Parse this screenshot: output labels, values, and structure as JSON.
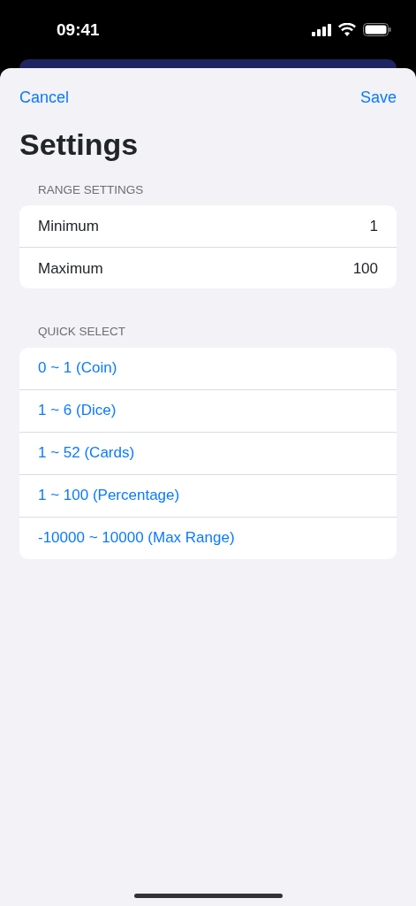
{
  "status_bar": {
    "time": "09:41"
  },
  "nav": {
    "cancel": "Cancel",
    "save": "Save"
  },
  "title": "Settings",
  "range_section": {
    "header": "RANGE SETTINGS",
    "rows": [
      {
        "label": "Minimum",
        "value": "1"
      },
      {
        "label": "Maximum",
        "value": "100"
      }
    ]
  },
  "quick_section": {
    "header": "QUICK SELECT",
    "items": [
      "0 ~ 1 (Coin)",
      "1 ~ 6 (Dice)",
      "1 ~ 52 (Cards)",
      "1 ~ 100 (Percentage)",
      "-10000 ~ 10000 (Max Range)"
    ]
  }
}
